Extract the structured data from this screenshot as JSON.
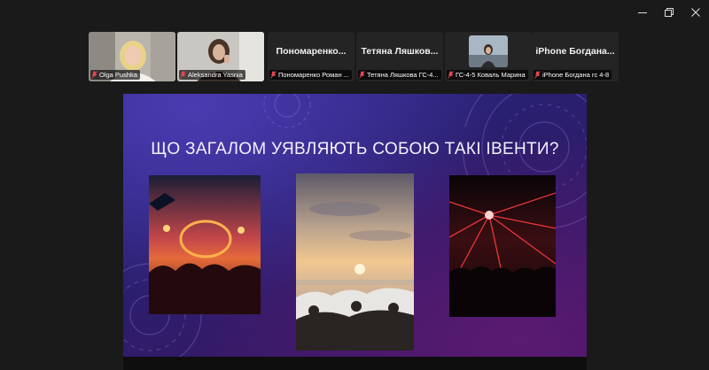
{
  "window": {
    "controls": [
      "minimize-icon",
      "restore-icon",
      "close-icon"
    ]
  },
  "participants": [
    {
      "label": "Olga Pushka",
      "type": "video",
      "muted": true
    },
    {
      "label": "Aleksandra Yasnia",
      "type": "video",
      "muted": true,
      "active_speaker": true
    },
    {
      "display_name": "Пономаренко...",
      "label": "Пономаренко Роман ...",
      "type": "name",
      "muted": true
    },
    {
      "display_name": "Тетяна  Ляшков...",
      "label": "Тетяна Ляшкова ГС-4...",
      "type": "name",
      "muted": true
    },
    {
      "label": "ГС-4-5 Коваль Марина",
      "type": "video",
      "muted": true
    },
    {
      "display_name": "iPhone  Богдана...",
      "label": "iPhone Богдана гс 4-8",
      "type": "name",
      "muted": true
    }
  ],
  "slide": {
    "title": "ЩО ЗАГАЛОМ УЯВЛЯЮТЬ СОБОЮ ТАКІ ІВЕНТИ?",
    "photos": [
      "concert-photo",
      "beach-party-photo",
      "laser-club-photo"
    ]
  },
  "colors": {
    "active_speaker": "#2ed26e",
    "muted_icon": "#e5484d",
    "slide_bg": "#2c2b8a"
  }
}
